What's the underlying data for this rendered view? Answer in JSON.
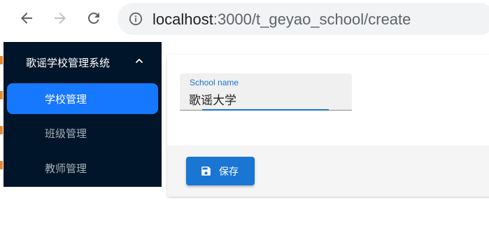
{
  "browser": {
    "url_host": "localhost",
    "url_path": ":3000/t_geyao_school/create",
    "back_icon": "back-arrow-icon",
    "forward_icon": "forward-arrow-icon",
    "reload_icon": "reload-icon",
    "info_icon": "info-icon"
  },
  "sidebar": {
    "title": "歌谣学校管理系统",
    "caret_icon": "chevron-up-icon",
    "items": [
      {
        "label": "学校管理",
        "active": true
      },
      {
        "label": "班级管理",
        "active": false
      },
      {
        "label": "教师管理",
        "active": false
      }
    ]
  },
  "form": {
    "school_name_label": "School name",
    "school_name_value": "歌谣大学"
  },
  "toolbar": {
    "save_label": "保存",
    "save_icon": "floppy-disk-icon"
  },
  "colors": {
    "sidebar_bg": "#001529",
    "active_item": "#1677ff",
    "primary": "#1976d2"
  }
}
